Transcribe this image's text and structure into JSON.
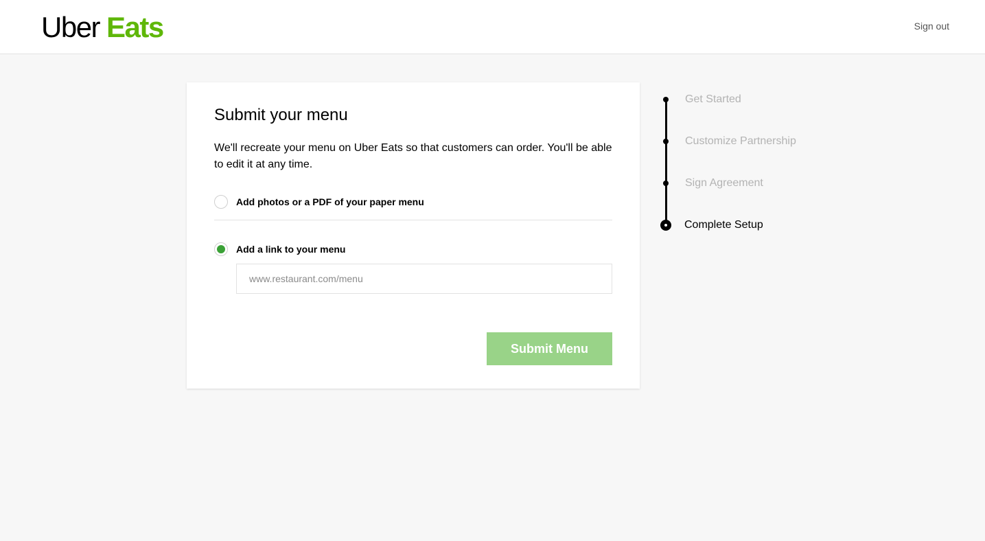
{
  "header": {
    "logo_uber": "Uber",
    "logo_eats": "Eats",
    "sign_out": "Sign out",
    "accent_color": "#5fb709"
  },
  "card": {
    "title": "Submit your menu",
    "description": "We'll recreate your menu on Uber Eats so that customers can order. You'll be able to edit it at any time.",
    "options": [
      {
        "label": "Add photos or a PDF of your paper menu",
        "selected": false
      },
      {
        "label": "Add a link to your menu",
        "selected": true
      }
    ],
    "link_input": {
      "value": "",
      "placeholder": "www.restaurant.com/menu"
    },
    "submit_label": "Submit Menu",
    "submit_color": "#99d388",
    "radio_color": "#3aa136"
  },
  "stepper": {
    "steps": [
      {
        "label": "Get Started",
        "state": "done"
      },
      {
        "label": "Customize Partnership",
        "state": "done"
      },
      {
        "label": "Sign Agreement",
        "state": "done"
      },
      {
        "label": "Complete Setup",
        "state": "current"
      }
    ]
  }
}
